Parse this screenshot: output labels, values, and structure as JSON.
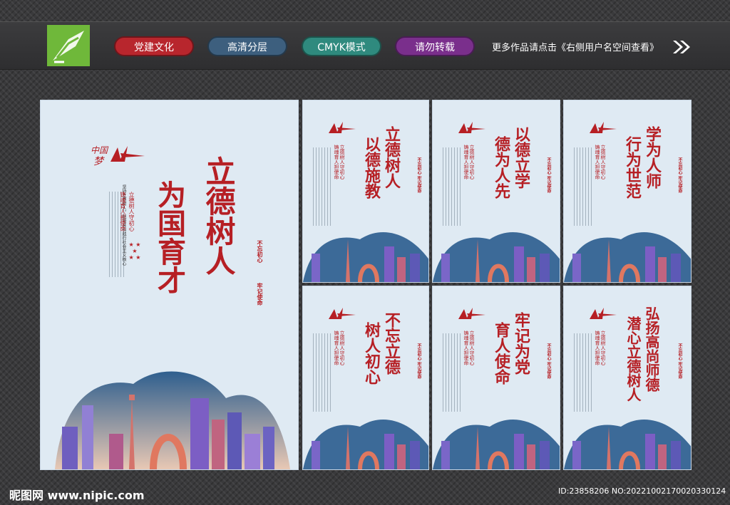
{
  "banner": {
    "tags": [
      "党建文化",
      "高清分层",
      "CMYK模式",
      "请勿转载"
    ],
    "note": "更多作品请点击《右侧用户名空间查看》",
    "logo_icon": "pen-nib-logo-icon",
    "arrow_icon": "double-chevron-right-icon"
  },
  "main_panel": {
    "title_col1": "立德树人",
    "title_col2": "为国育才",
    "motto_col1": "立德树人守初心",
    "motto_col2": "铸魂育人担使命",
    "body_text": [
      "坚持立德树人，",
      "把培育和践行社会主义核心",
      "价值观融入教书育人全过程，",
      "把握高校意识形态工作领导权，",
      "强化思想引领，",
      "牢年下校院长负责制，",
      "坚持和完善党委领导",
      "作用和共产党员先锋模范作用"
    ],
    "seal_col1": "不忘初心",
    "seal_col2": "牢记使命"
  },
  "small_panels": [
    {
      "title_col1": "立德树人",
      "title_col2": "以德施教"
    },
    {
      "title_col1": "以德立学",
      "title_col2": "德为人先"
    },
    {
      "title_col1": "学为人师",
      "title_col2": "行为世范"
    },
    {
      "title_col1": "不忘立德",
      "title_col2": "树人初心"
    },
    {
      "title_col1": "牢记为党",
      "title_col2": "育人使命"
    },
    {
      "title_col1": "弘扬高尚师德",
      "title_col2": "潜心立德树人"
    }
  ],
  "small_motto_col1": "立德树人守初心",
  "small_motto_col2": "铸魂育人担使命",
  "small_seal": "不忘初心 牢记使命",
  "footer": {
    "site": "昵图网 www.nipic.com",
    "id": "ID:23858206 NO:20221002170020330124"
  },
  "colors": {
    "accent_red": "#b61f24",
    "panel_bg": "#dfeaf3",
    "banner_bg": "#2e2e30"
  }
}
